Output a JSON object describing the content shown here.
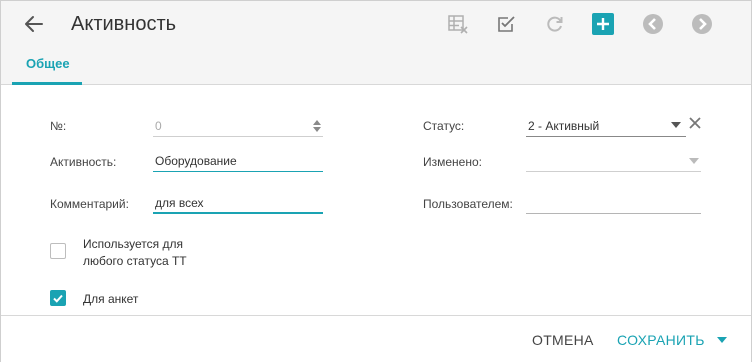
{
  "header": {
    "title": "Активность",
    "tabs": [
      {
        "label": "Общее",
        "active": true
      }
    ],
    "toolbar": [
      "table-clear-icon",
      "checkbox-check-icon",
      "refresh-icon",
      "add-icon",
      "prev-circle-icon",
      "next-circle-icon"
    ]
  },
  "form": {
    "number": {
      "label": "№:",
      "value": "0"
    },
    "activity": {
      "label": "Активность:",
      "value": "Оборудование"
    },
    "comment": {
      "label": "Комментарий:",
      "value": "для всех"
    },
    "status": {
      "label": "Статус:",
      "value": "2 - Активный"
    },
    "changed": {
      "label": "Изменено:",
      "value": ""
    },
    "user": {
      "label": "Пользователем:",
      "value": ""
    },
    "any_status": {
      "label_line1": "Используется для",
      "label_line2": "любого статуса ТТ",
      "checked": false
    },
    "for_surveys": {
      "label": "Для анкет",
      "checked": true
    }
  },
  "footer": {
    "cancel_label": "ОТМЕНА",
    "save_label": "СОХРАНИТЬ"
  },
  "colors": {
    "accent": "#1aa3b3",
    "header_bg": "#f5f5f5"
  }
}
